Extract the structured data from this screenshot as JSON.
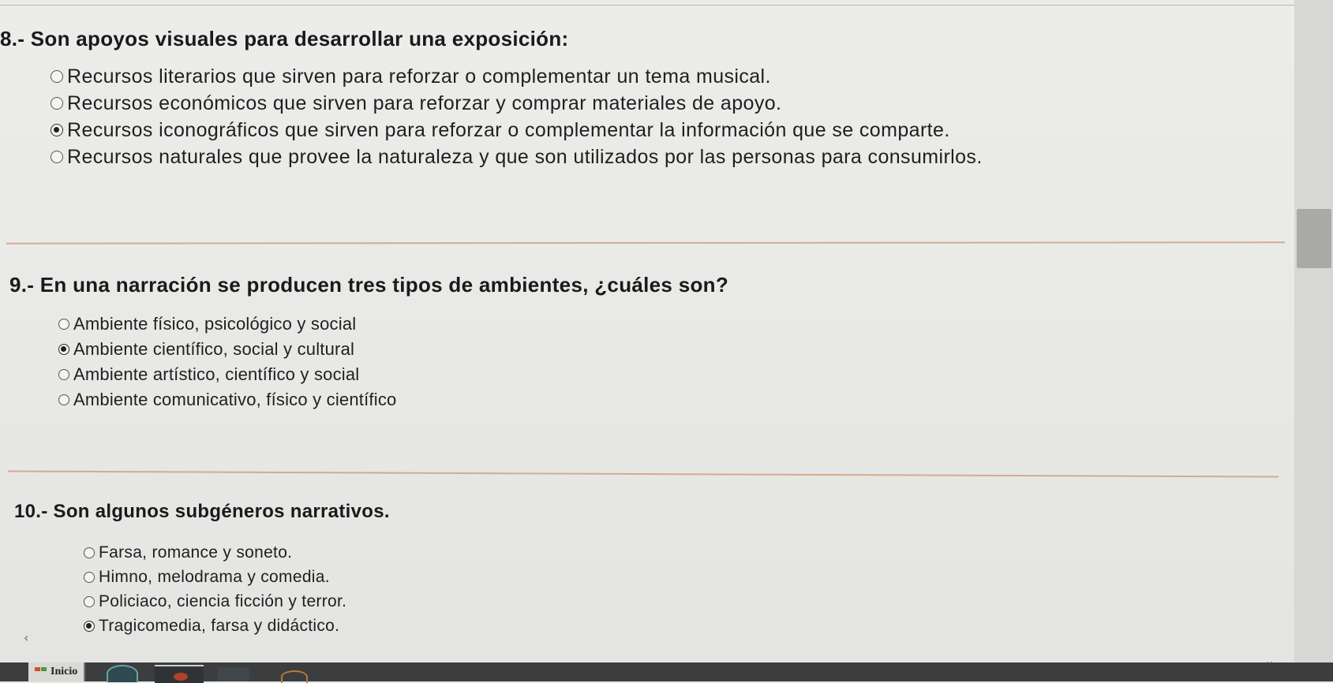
{
  "questions": [
    {
      "id": "q8",
      "title": "8.- Son apoyos visuales para desarrollar una exposición:",
      "options": [
        {
          "label": "Recursos literarios que sirven para reforzar o complementar un tema musical.",
          "checked": false
        },
        {
          "label": "Recursos económicos que sirven para reforzar y comprar materiales de apoyo.",
          "checked": false
        },
        {
          "label": "Recursos iconográficos que sirven para reforzar o complementar la información que se comparte.",
          "checked": true
        },
        {
          "label": "Recursos naturales que provee la naturaleza y que son utilizados por las personas para consumirlos.",
          "checked": false
        }
      ]
    },
    {
      "id": "q9",
      "title": "9.- En una narración se producen tres tipos de ambientes, ¿cuáles son?",
      "options": [
        {
          "label": "Ambiente físico, psicológico y social",
          "checked": false
        },
        {
          "label": "Ambiente científico, social y cultural",
          "checked": true
        },
        {
          "label": "Ambiente artístico, científico y social",
          "checked": false
        },
        {
          "label": "Ambiente comunicativo, físico y científico",
          "checked": false
        }
      ]
    },
    {
      "id": "q10",
      "title": "10.- Son algunos subgéneros narrativos.",
      "options": [
        {
          "label": "Farsa, romance y soneto.",
          "checked": false
        },
        {
          "label": "Himno, melodrama y comedia.",
          "checked": false
        },
        {
          "label": "Policiaco, ciencia ficción y terror.",
          "checked": false
        },
        {
          "label": "Tragicomedia, farsa y didáctico.",
          "checked": true
        }
      ]
    }
  ],
  "taskbar": {
    "start_label": "Inicio",
    "icons": [
      "start-icon",
      "app-icon",
      "app-icon",
      "app-icon",
      "app-icon"
    ]
  },
  "icons": {
    "left_arrow": "‹",
    "scroll_down": "⌄"
  },
  "colors": {
    "separator": "#c88a66",
    "background": "#e9e9e7",
    "taskbar": "#3b3d3f"
  }
}
